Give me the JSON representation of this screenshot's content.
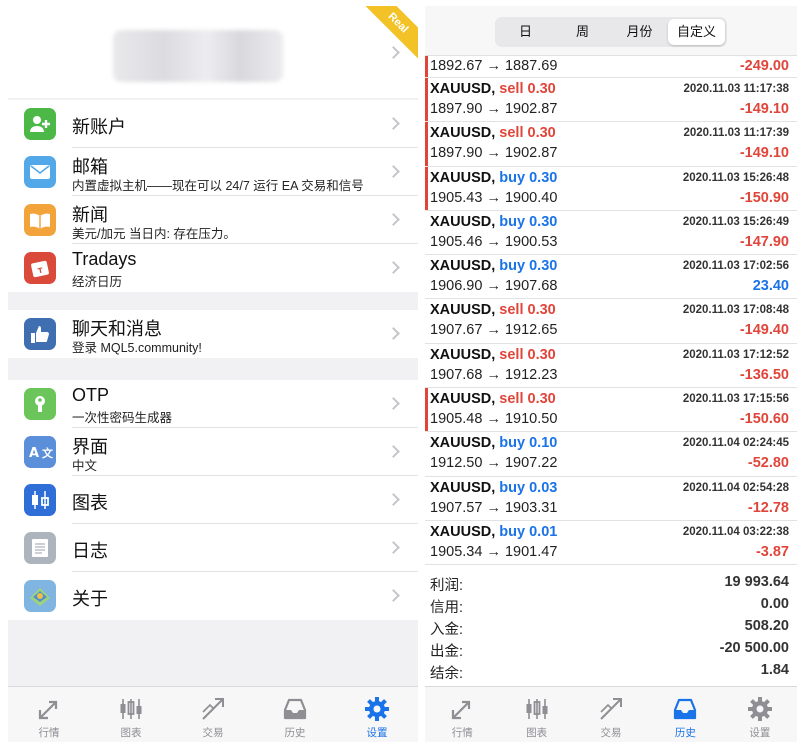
{
  "settings": {
    "ribbon_label": "Real",
    "group1": [
      {
        "title": "新账户",
        "subtitle": "",
        "icon": "new-account-icon",
        "color": "#4cb848"
      },
      {
        "title": "邮箱",
        "subtitle": "内置虚拟主机——现在可以 24/7 运行 EA 交易和信号",
        "icon": "mail-icon",
        "color": "#52a8e8"
      },
      {
        "title": "新闻",
        "subtitle": "美元/加元 当日内: 存在压力。",
        "icon": "news-icon",
        "color": "#f2a33a"
      },
      {
        "title": "Tradays",
        "subtitle": "经济日历",
        "icon": "tradays-icon",
        "color": "#d94a3a"
      }
    ],
    "group2": [
      {
        "title": "聊天和消息",
        "subtitle": "登录 MQL5.community!",
        "icon": "chat-icon",
        "color": "#3f6fb0"
      }
    ],
    "group3": [
      {
        "title": "OTP",
        "subtitle": "一次性密码生成器",
        "icon": "otp-icon",
        "color": "#6cc55a"
      },
      {
        "title": "界面",
        "subtitle": "中文",
        "icon": "language-icon",
        "color": "#5b8fd9"
      },
      {
        "title": "图表",
        "subtitle": "",
        "icon": "chart-icon",
        "color": "#2f6ed6"
      },
      {
        "title": "日志",
        "subtitle": "",
        "icon": "journal-icon",
        "color": "#aeb4bd"
      },
      {
        "title": "关于",
        "subtitle": "",
        "icon": "about-icon",
        "color": "#7fb5e0"
      }
    ],
    "tabs": [
      {
        "label": "行情",
        "icon": "quotes-icon",
        "active": false
      },
      {
        "label": "图表",
        "icon": "chart-candles-icon",
        "active": false
      },
      {
        "label": "交易",
        "icon": "trade-icon",
        "active": false
      },
      {
        "label": "历史",
        "icon": "history-icon",
        "active": false
      },
      {
        "label": "设置",
        "icon": "gear-icon",
        "active": true
      }
    ]
  },
  "history": {
    "periods": [
      {
        "label": "日",
        "active": false
      },
      {
        "label": "周",
        "active": false
      },
      {
        "label": "月份",
        "active": false
      },
      {
        "label": "自定义",
        "active": true
      }
    ],
    "first_partial": {
      "prices": "1892.67 → 1887.69",
      "profit": "-249.00",
      "sign": "neg",
      "marked": true
    },
    "deals": [
      {
        "symbol": "XAUUSD,",
        "side": "sell",
        "volume": "sell 0.30",
        "time": "2020.11.03 11:17:38",
        "prices": "1897.90 → 1902.87",
        "profit": "-149.10",
        "sign": "neg",
        "marked": true
      },
      {
        "symbol": "XAUUSD,",
        "side": "sell",
        "volume": "sell 0.30",
        "time": "2020.11.03 11:17:39",
        "prices": "1897.90 → 1902.87",
        "profit": "-149.10",
        "sign": "neg",
        "marked": true
      },
      {
        "symbol": "XAUUSD,",
        "side": "buy",
        "volume": "buy 0.30",
        "time": "2020.11.03 15:26:48",
        "prices": "1905.43 → 1900.40",
        "profit": "-150.90",
        "sign": "neg",
        "marked": true
      },
      {
        "symbol": "XAUUSD,",
        "side": "buy",
        "volume": "buy 0.30",
        "time": "2020.11.03 15:26:49",
        "prices": "1905.46 → 1900.53",
        "profit": "-147.90",
        "sign": "neg",
        "marked": false
      },
      {
        "symbol": "XAUUSD,",
        "side": "buy",
        "volume": "buy 0.30",
        "time": "2020.11.03 17:02:56",
        "prices": "1906.90 → 1907.68",
        "profit": "23.40",
        "sign": "pos",
        "marked": false
      },
      {
        "symbol": "XAUUSD,",
        "side": "sell",
        "volume": "sell 0.30",
        "time": "2020.11.03 17:08:48",
        "prices": "1907.67 → 1912.65",
        "profit": "-149.40",
        "sign": "neg",
        "marked": false
      },
      {
        "symbol": "XAUUSD,",
        "side": "sell",
        "volume": "sell 0.30",
        "time": "2020.11.03 17:12:52",
        "prices": "1907.68 → 1912.23",
        "profit": "-136.50",
        "sign": "neg",
        "marked": false
      },
      {
        "symbol": "XAUUSD,",
        "side": "sell",
        "volume": "sell 0.30",
        "time": "2020.11.03 17:15:56",
        "prices": "1905.48 → 1910.50",
        "profit": "-150.60",
        "sign": "neg",
        "marked": true
      },
      {
        "symbol": "XAUUSD,",
        "side": "buy",
        "volume": "buy 0.10",
        "time": "2020.11.04 02:24:45",
        "prices": "1912.50 → 1907.22",
        "profit": "-52.80",
        "sign": "neg",
        "marked": false
      },
      {
        "symbol": "XAUUSD,",
        "side": "buy",
        "volume": "buy 0.03",
        "time": "2020.11.04 02:54:28",
        "prices": "1907.57 → 1903.31",
        "profit": "-12.78",
        "sign": "neg",
        "marked": false
      },
      {
        "symbol": "XAUUSD,",
        "side": "buy",
        "volume": "buy 0.01",
        "time": "2020.11.04 03:22:38",
        "prices": "1905.34 → 1901.47",
        "profit": "-3.87",
        "sign": "neg",
        "marked": false
      }
    ],
    "summary": [
      {
        "label": "利润:",
        "value": "19 993.64"
      },
      {
        "label": "信用:",
        "value": "0.00"
      },
      {
        "label": "入金:",
        "value": "508.20"
      },
      {
        "label": "出金:",
        "value": "-20 500.00"
      },
      {
        "label": "结余:",
        "value": "1.84"
      }
    ],
    "tabs": [
      {
        "label": "行情",
        "icon": "quotes-icon",
        "active": false
      },
      {
        "label": "图表",
        "icon": "chart-candles-icon",
        "active": false
      },
      {
        "label": "交易",
        "icon": "trade-icon",
        "active": false
      },
      {
        "label": "历史",
        "icon": "history-icon",
        "active": true
      },
      {
        "label": "设置",
        "icon": "gear-icon",
        "active": false
      }
    ]
  },
  "colors": {
    "accent": "#1a73e8",
    "loss": "#e0453a",
    "ribbon": "#f2c227"
  }
}
